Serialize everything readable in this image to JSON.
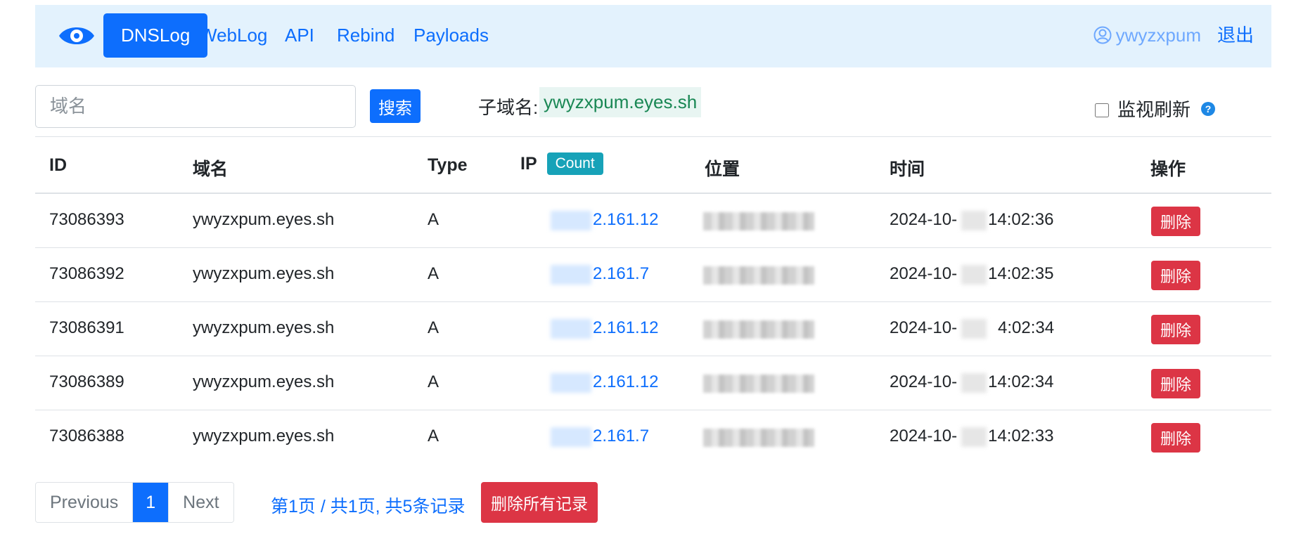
{
  "nav": {
    "items": [
      {
        "label": "DNSLog",
        "active": true
      },
      {
        "label": "WebLog",
        "active": false
      },
      {
        "label": "API",
        "active": false
      },
      {
        "label": "Rebind",
        "active": false
      },
      {
        "label": "Payloads",
        "active": false
      }
    ],
    "username": "ywyzxpum",
    "logout": "退出"
  },
  "search": {
    "placeholder": "域名",
    "value": "",
    "button": "搜索"
  },
  "subdomain": {
    "label": "子域名:",
    "value": "ywyzxpum.eyes.sh"
  },
  "monitor": {
    "label": "监视刷新",
    "checked": false,
    "help": "?"
  },
  "table": {
    "headers": {
      "id": "ID",
      "domain": "域名",
      "type": "Type",
      "ip": "IP",
      "count": "Count",
      "location": "位置",
      "time": "时间",
      "action": "操作"
    },
    "rows": [
      {
        "id": "73086393",
        "domain": "ywyzxpum.eyes.sh",
        "type": "A",
        "ip": "2.161.12",
        "time_prefix": "2024-10-",
        "time_suffix": "14:02:36",
        "delete": "删除"
      },
      {
        "id": "73086392",
        "domain": "ywyzxpum.eyes.sh",
        "type": "A",
        "ip": "2.161.7",
        "time_prefix": "2024-10-",
        "time_suffix": "14:02:35",
        "delete": "删除"
      },
      {
        "id": "73086391",
        "domain": "ywyzxpum.eyes.sh",
        "type": "A",
        "ip": "2.161.12",
        "time_prefix": "2024-10-",
        "time_suffix": "4:02:34",
        "delete": "删除"
      },
      {
        "id": "73086389",
        "domain": "ywyzxpum.eyes.sh",
        "type": "A",
        "ip": "2.161.12",
        "time_prefix": "2024-10-",
        "time_suffix": "14:02:34",
        "delete": "删除"
      },
      {
        "id": "73086388",
        "domain": "ywyzxpum.eyes.sh",
        "type": "A",
        "ip": "2.161.7",
        "time_prefix": "2024-10-",
        "time_suffix": "14:02:33",
        "delete": "删除"
      }
    ]
  },
  "pagination": {
    "previous": "Previous",
    "current": "1",
    "next": "Next",
    "info": "第1页 / 共1页, 共5条记录",
    "delete_all": "删除所有记录"
  },
  "colors": {
    "primary": "#0d6efd",
    "navbar_bg": "#e3f2fd",
    "danger": "#dc3545",
    "badge": "#17a2b8",
    "subdomain_text": "#198754"
  }
}
